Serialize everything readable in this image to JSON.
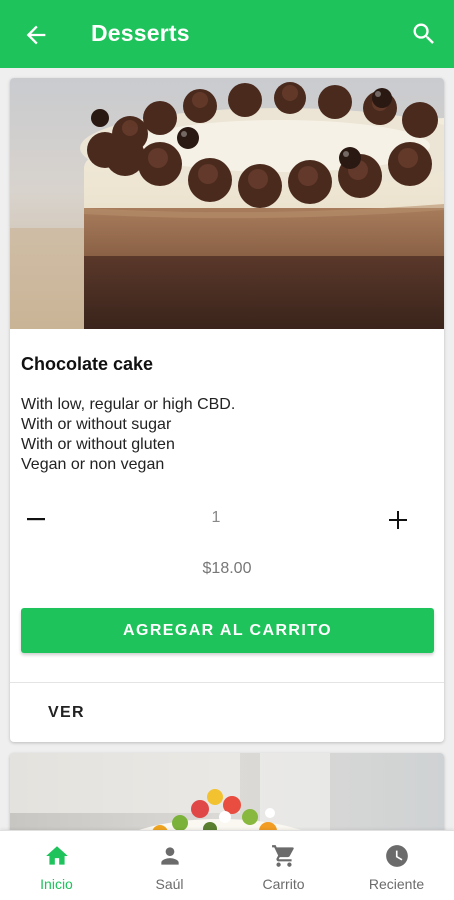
{
  "appbar": {
    "title": "Desserts",
    "back_icon": "arrow-back-icon",
    "search_icon": "search-icon"
  },
  "product": {
    "title": "Chocolate cake",
    "description": [
      "With low, regular or high CBD.",
      "With or without sugar",
      "With or without gluten",
      "Vegan or non vegan"
    ],
    "quantity": "1",
    "price": "$18.00",
    "add_button_label": "AGREGAR AL CARRITO",
    "view_button_label": "VER"
  },
  "bottom_nav": {
    "items": [
      {
        "label": "Inicio",
        "icon": "home-icon",
        "active": true
      },
      {
        "label": "Saúl",
        "icon": "person-icon",
        "active": false
      },
      {
        "label": "Carrito",
        "icon": "cart-icon",
        "active": false
      },
      {
        "label": "Reciente",
        "icon": "clock-icon",
        "active": false
      }
    ]
  },
  "colors": {
    "primary": "#1ec35b",
    "nav_inactive": "#6b6b6b",
    "background": "#efefef"
  }
}
